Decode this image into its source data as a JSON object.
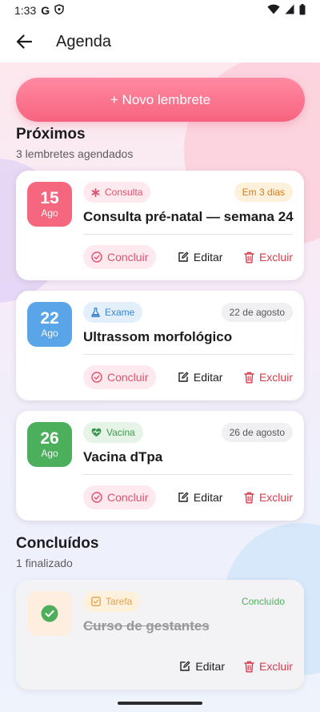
{
  "status_bar": {
    "time": "1:33"
  },
  "app_bar": {
    "title": "Agenda"
  },
  "actions": {
    "new_reminder": "+ Novo lembrete"
  },
  "upcoming": {
    "title": "Próximos",
    "subtitle": "3 lembretes agendados",
    "items": [
      {
        "day": "15",
        "month": "Ago",
        "tag": "Consulta",
        "tag_icon": "asterisk-icon",
        "when": "Em 3 dias",
        "title": "Consulta pré-natal — semana 24",
        "accent": "#f5677f",
        "tag_bg": "#fde9ee",
        "tag_color": "#e0506e",
        "when_bg": "#fdf1dc",
        "when_color": "#dc7a12"
      },
      {
        "day": "22",
        "month": "Ago",
        "tag": "Exame",
        "tag_icon": "flask-icon",
        "when": "22 de agosto",
        "title": "Ultrassom morfológico",
        "accent": "#5aa5e8",
        "tag_bg": "#e3f0fc",
        "tag_color": "#3b84cc",
        "when_bg": "#f0f0f3",
        "when_color": "#57555b"
      },
      {
        "day": "26",
        "month": "Ago",
        "tag": "Vacina",
        "tag_icon": "heart-pulse-icon",
        "when": "26 de agosto",
        "title": "Vacina dTpa",
        "accent": "#4caf5c",
        "tag_bg": "#e5f4e6",
        "tag_color": "#3c9a4c",
        "when_bg": "#f0f0f3",
        "when_color": "#57555b"
      }
    ]
  },
  "done": {
    "title": "Concluídos",
    "subtitle": "1 finalizado",
    "items": [
      {
        "tag": "Tarefa",
        "tag_icon": "checkbox-icon",
        "when": "Concluído",
        "title": "Curso de gestantes"
      }
    ]
  },
  "card_actions": {
    "concluir": "Concluir",
    "editar": "Editar",
    "excluir": "Excluir"
  }
}
